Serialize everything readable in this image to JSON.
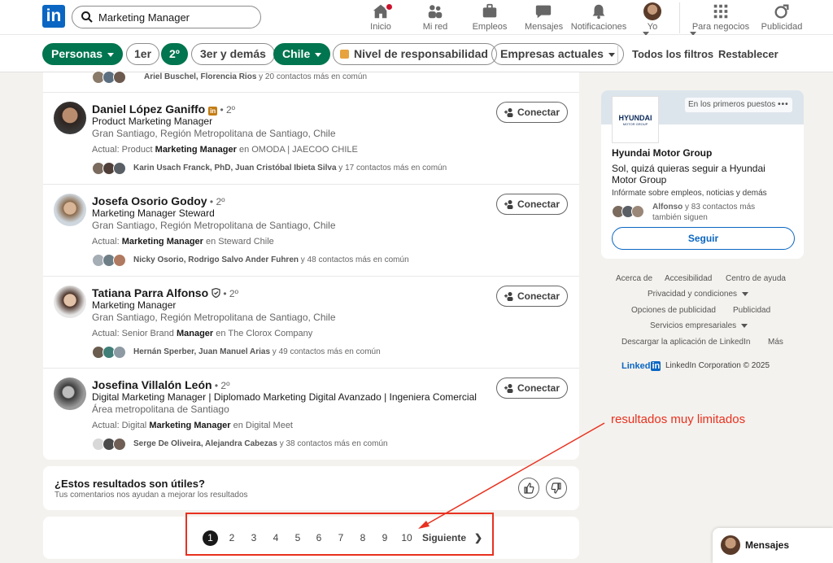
{
  "nav": {
    "search_value": "Marketing Manager",
    "items": [
      {
        "label": "Inicio"
      },
      {
        "label": "Mi red"
      },
      {
        "label": "Empleos"
      },
      {
        "label": "Mensajes"
      },
      {
        "label": "Notificaciones"
      },
      {
        "label": "Yo"
      },
      {
        "label": "Para negocios"
      },
      {
        "label": "Publicidad"
      }
    ]
  },
  "filters": {
    "pills": [
      "Personas",
      "1er",
      "2º",
      "3er y demás",
      "Chile",
      "Nivel de responsabilidad",
      "Empresas actuales"
    ],
    "all_filters": "Todos los filtros",
    "reset": "Restablecer"
  },
  "results": {
    "top_mutual": {
      "bold": "Ariel Buschel, Florencia Rios",
      "rest": " y 20 contactos más en común"
    },
    "people": [
      {
        "name": "Daniel López Ganiffo",
        "degree": " • 2º",
        "title": "Product Marketing Manager",
        "location": "Gran Santiago, Región Metropolitana de Santiago, Chile",
        "current_prefix": "Actual: Product ",
        "current_bold": "Marketing Manager",
        "current_suffix": " en OMODA | JAECOO CHILE",
        "mutual_bold": "Karin Usach Franck, PhD, Juan Cristóbal Ibieta Silva",
        "mutual_rest": " y 17 contactos más en común",
        "connect": "Conectar"
      },
      {
        "name": "Josefa Osorio Godoy",
        "degree": " • 2º",
        "title": "Marketing Manager Steward",
        "location": "Gran Santiago, Región Metropolitana de Santiago, Chile",
        "current_prefix": "Actual: ",
        "current_bold": "Marketing Manager",
        "current_suffix": " en Steward Chile",
        "mutual_bold": "Nicky Osorio, Rodrigo Salvo Ander Fuhren",
        "mutual_rest": " y 48 contactos más en común",
        "connect": "Conectar"
      },
      {
        "name": "Tatiana Parra Alfonso",
        "degree": " • 2º",
        "title": "Marketing Manager",
        "location": "Gran Santiago, Región Metropolitana de Santiago, Chile",
        "current_prefix": "Actual: Senior Brand ",
        "current_bold": "Manager",
        "current_suffix": " en The Clorox Company",
        "mutual_bold": "Hernán Sperber, Juan Manuel Arias",
        "mutual_rest": " y 49 contactos más en común",
        "connect": "Conectar"
      },
      {
        "name": "Josefina Villalón León",
        "degree": " • 2º",
        "title": "Digital Marketing Manager | Diplomado Marketing Digital Avanzado | Ingeniera Comercial",
        "location": "Área metropolitana de Santiago",
        "current_prefix": "Actual: Digital ",
        "current_bold": "Marketing Manager",
        "current_suffix": " en Digital Meet",
        "mutual_bold": "Serge De Oliveira, Alejandra Cabezas",
        "mutual_rest": " y 38 contactos más en común",
        "connect": "Conectar"
      }
    ]
  },
  "feedback": {
    "question": "¿Estos resultados son útiles?",
    "subtext": "Tus comentarios nos ayudan a mejorar los resultados"
  },
  "pagination": {
    "pages": [
      "1",
      "2",
      "3",
      "4",
      "5",
      "6",
      "7",
      "8",
      "9",
      "10"
    ],
    "current": 1,
    "next": "Siguiente"
  },
  "ad": {
    "promoted": "En los primeros puestos",
    "logo_text": "HYUNDAI",
    "logo_sub": "MOTOR GROUP",
    "company": "Hyundai Motor Group",
    "headline": "Sol, quizá quieras seguir a Hyundai Motor Group",
    "desc": "Infórmate sobre empleos, noticias y demás",
    "followers_bold": "Alfonso",
    "followers_rest": " y 83 contactos más también siguen",
    "follow": "Seguir"
  },
  "footer": {
    "links": [
      "Acerca de",
      "Accesibilidad",
      "Centro de ayuda",
      "Privacidad y condiciones",
      "Opciones de publicidad",
      "Publicidad",
      "Servicios empresariales",
      "Descargar la aplicación de LinkedIn",
      "Más"
    ],
    "brand": "Linked",
    "brand_in": "in",
    "copyright": "LinkedIn Corporation © 2025"
  },
  "annotation": "resultados muy limitados",
  "messaging": "Mensajes",
  "colors": {
    "linkedin_blue": "#0a66c2",
    "filter_green": "#01754f",
    "annotation_red": "#e8311f"
  }
}
